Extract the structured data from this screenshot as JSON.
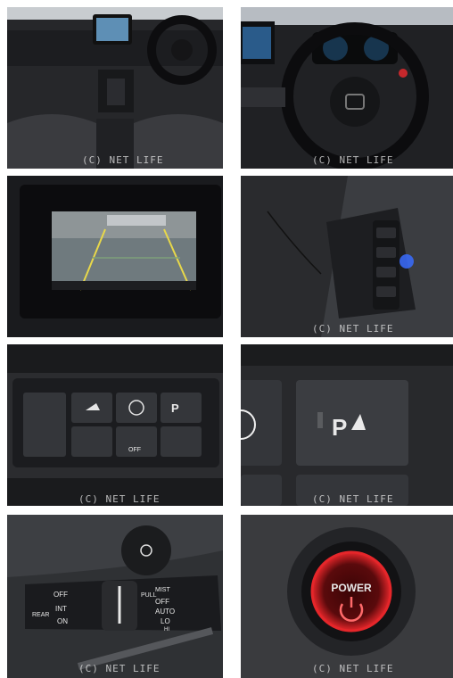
{
  "watermark": "(C) NET LIFE",
  "photos": [
    {
      "id": 1,
      "subject": "dashboard-interior",
      "wm": "(C) NET LIFE"
    },
    {
      "id": 2,
      "subject": "steering-wheel-cluster",
      "wm": "(C) NET LIFE"
    },
    {
      "id": 3,
      "subject": "rear-camera-display",
      "wm": ""
    },
    {
      "id": 4,
      "subject": "side-switch-panel",
      "wm": "(C) NET LIFE"
    },
    {
      "id": 5,
      "subject": "lower-switch-bank",
      "wm": "(C) NET LIFE"
    },
    {
      "id": 6,
      "subject": "parking-sensor-button",
      "wm": "(C) NET LIFE"
    },
    {
      "id": 7,
      "subject": "wiper-stalk",
      "wm": "(C) NET LIFE"
    },
    {
      "id": 8,
      "subject": "power-button",
      "wm": "(C) NET LIFE"
    }
  ],
  "labels": {
    "parking_button": "P",
    "power_button": "POWER",
    "wiper_mist": "MIST",
    "wiper_off": "OFF",
    "wiper_auto": "AUTO",
    "wiper_lo": "LO",
    "wiper_hi": "HI",
    "rear_wiper_rear": "REAR",
    "rear_wiper_off": "OFF",
    "rear_wiper_int": "INT",
    "rear_wiper_on": "ON",
    "pull_label": "PULL",
    "switch_off": "OFF"
  },
  "colors": {
    "power_glow": "#e5262a",
    "display_green": "#7fa07a",
    "switch_blue": "#3a6cff"
  }
}
